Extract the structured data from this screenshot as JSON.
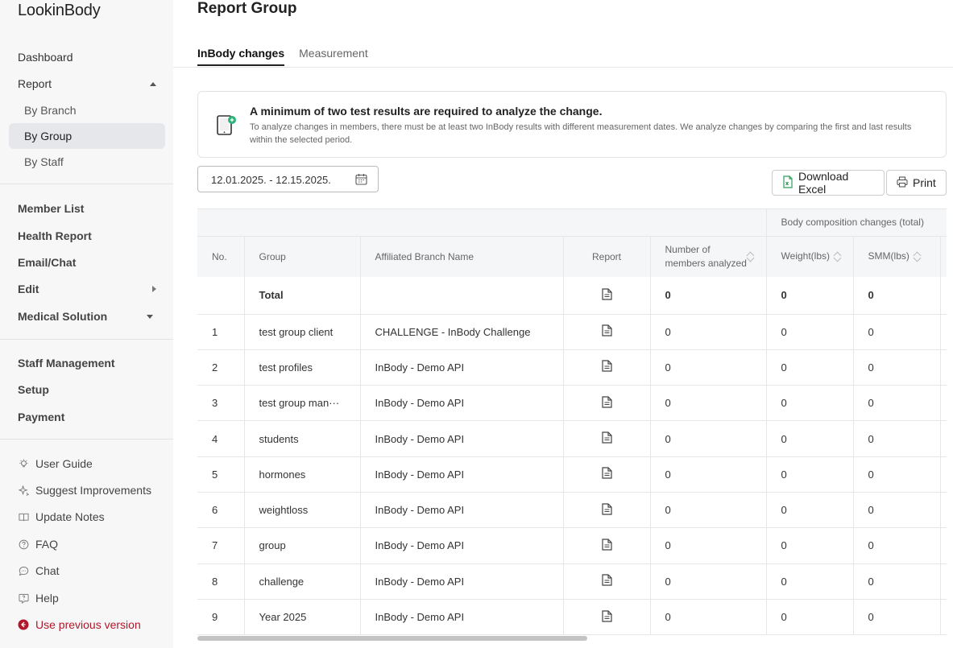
{
  "sidebar": {
    "logo": "LookinBody",
    "dashboard": "Dashboard",
    "report": "Report",
    "report_sub": [
      "By Branch",
      "By Group",
      "By Staff"
    ],
    "member_list": "Member List",
    "health_report": "Health Report",
    "email_chat": "Email/Chat",
    "edit": "Edit",
    "medical_solution": "Medical Solution",
    "staff_management": "Staff Management",
    "setup": "Setup",
    "payment": "Payment",
    "help_items": [
      "User Guide",
      "Suggest Improvements",
      "Update Notes",
      "FAQ",
      "Chat",
      "Help"
    ],
    "use_previous": "Use previous version"
  },
  "page": {
    "title": "Report Group",
    "tabs": [
      "InBody changes",
      "Measurement"
    ]
  },
  "notice": {
    "title": "A minimum of two test results are required to analyze the change.",
    "text": "To analyze changes in members, there must be at least two InBody results with different measurement dates. We analyze changes by comparing the first and last results within the selected period."
  },
  "filters": {
    "date_range": "12.01.2025. - 12.15.2025.",
    "download_excel": "Download Excel",
    "print": "Print"
  },
  "table": {
    "group_header": "Body composition changes (total)",
    "headers": [
      "No.",
      "Group",
      "Affiliated Branch Name",
      "Report",
      "Number of members analyzed",
      "Weight(lbs)",
      "SMM(lbs)"
    ],
    "total": {
      "label": "Total",
      "members": "0",
      "weight": "0",
      "smm": "0"
    },
    "rows": [
      {
        "no": "1",
        "group": "test group client",
        "branch": "CHALLENGE - InBody Challenge",
        "members": "0",
        "weight": "0",
        "smm": "0"
      },
      {
        "no": "2",
        "group": "test profiles",
        "branch": "InBody - Demo API",
        "members": "0",
        "weight": "0",
        "smm": "0"
      },
      {
        "no": "3",
        "group": "test group man···",
        "branch": "InBody - Demo API",
        "members": "0",
        "weight": "0",
        "smm": "0"
      },
      {
        "no": "4",
        "group": "students",
        "branch": "InBody - Demo API",
        "members": "0",
        "weight": "0",
        "smm": "0"
      },
      {
        "no": "5",
        "group": "hormones",
        "branch": "InBody - Demo API",
        "members": "0",
        "weight": "0",
        "smm": "0"
      },
      {
        "no": "6",
        "group": "weightloss",
        "branch": "InBody - Demo API",
        "members": "0",
        "weight": "0",
        "smm": "0"
      },
      {
        "no": "7",
        "group": "group",
        "branch": "InBody - Demo API",
        "members": "0",
        "weight": "0",
        "smm": "0"
      },
      {
        "no": "8",
        "group": "challenge",
        "branch": "InBody - Demo API",
        "members": "0",
        "weight": "0",
        "smm": "0"
      },
      {
        "no": "9",
        "group": "Year 2025",
        "branch": "InBody - Demo API",
        "members": "0",
        "weight": "0",
        "smm": "0"
      }
    ]
  }
}
